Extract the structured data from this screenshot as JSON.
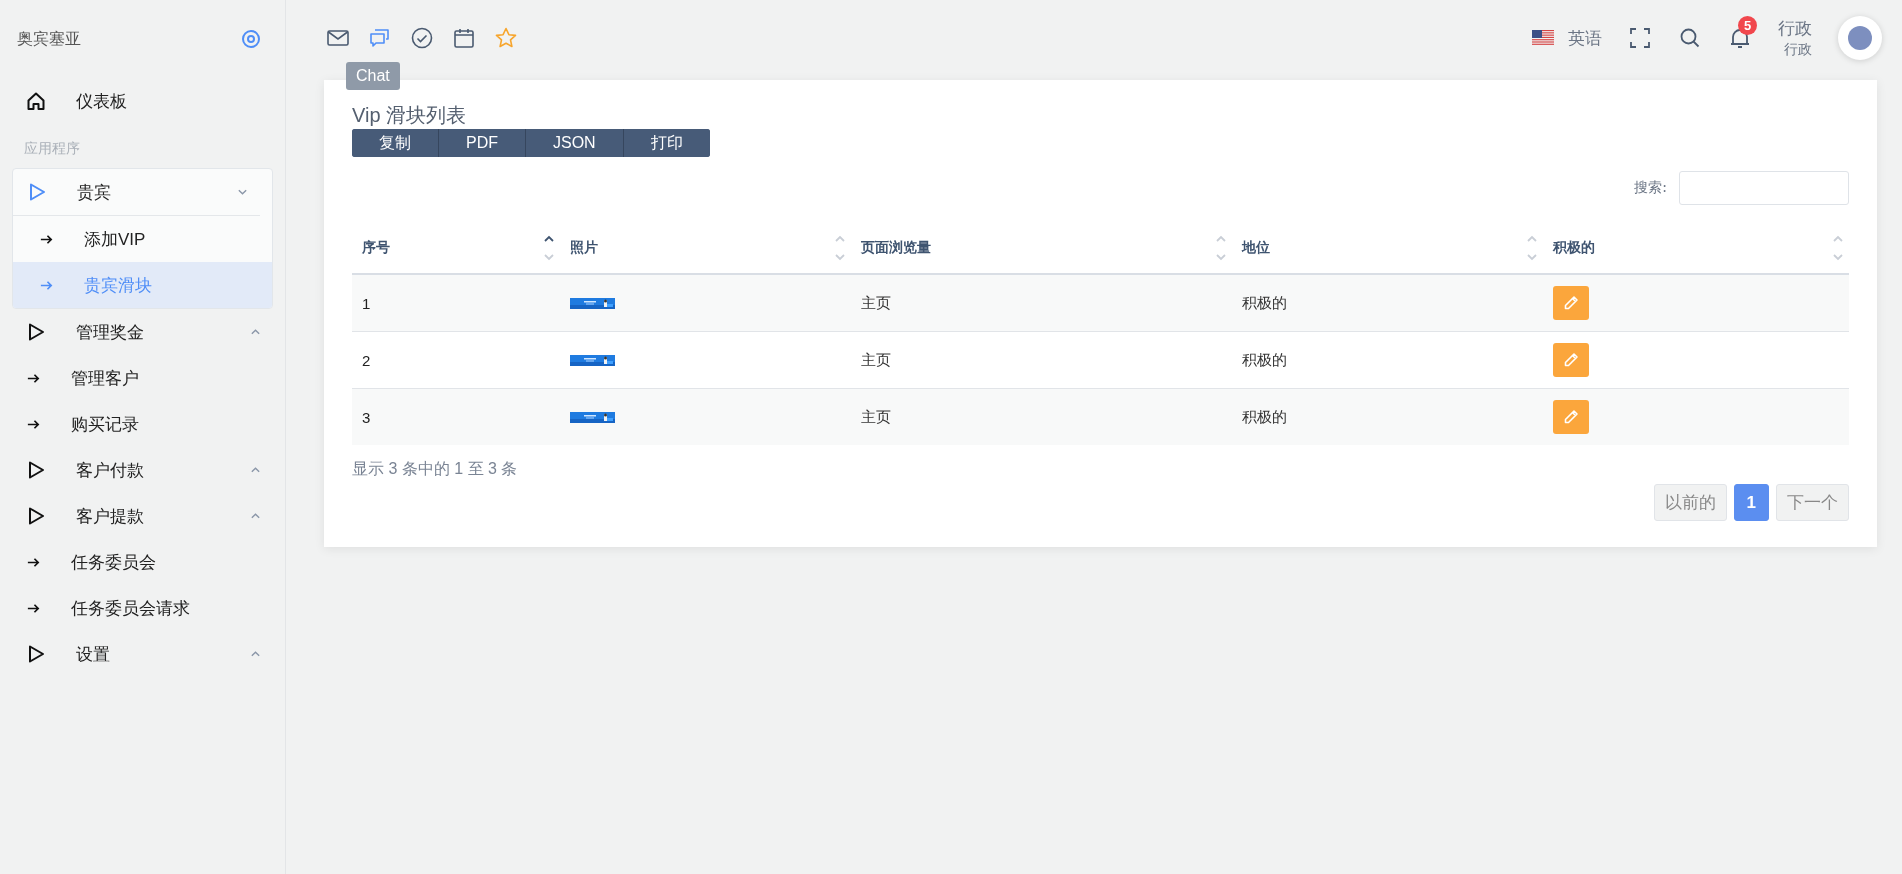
{
  "sidebar": {
    "brand": "奥宾塞亚",
    "items": [
      {
        "kind": "home",
        "label": "仪表板",
        "selected": false
      },
      {
        "kind": "section",
        "label": "应用程序"
      },
      {
        "kind": "group",
        "label": "贵宾",
        "expanded": true,
        "children": [
          {
            "label": "添加VIP",
            "selected": false
          },
          {
            "label": "贵宾滑块",
            "selected": true
          }
        ]
      },
      {
        "kind": "group",
        "label": "管理奖金",
        "expanded": false
      },
      {
        "kind": "link",
        "label": "管理客户",
        "selected": false
      },
      {
        "kind": "link",
        "label": "购买记录",
        "selected": false
      },
      {
        "kind": "group",
        "label": "客户付款",
        "expanded": false
      },
      {
        "kind": "group",
        "label": "客户提款",
        "expanded": false
      },
      {
        "kind": "link",
        "label": "任务委员会",
        "selected": false
      },
      {
        "kind": "link",
        "label": "任务委员会请求",
        "selected": false
      },
      {
        "kind": "group",
        "label": "设置",
        "expanded": false
      }
    ]
  },
  "topbar": {
    "apps": [
      {
        "kind": "mail",
        "selected": false
      },
      {
        "kind": "chat",
        "selected": true
      },
      {
        "kind": "check",
        "selected": false
      },
      {
        "kind": "calendar",
        "selected": false
      },
      {
        "kind": "star",
        "selected": false
      }
    ],
    "tooltip": "Chat",
    "language": "英语",
    "notifications": "5",
    "user_name": "行政",
    "user_role": "行政"
  },
  "card": {
    "title": "Vip 滑块列表",
    "export_buttons": [
      "复制",
      "PDF",
      "JSON",
      "打印"
    ],
    "search_label": "搜索:",
    "table": {
      "columns": [
        {
          "label": "序号",
          "sorted_ascending": true
        },
        {
          "label": "照片",
          "sorted_ascending": false
        },
        {
          "label": "页面浏览量",
          "sorted_ascending": false
        },
        {
          "label": "地位",
          "sorted_ascending": false
        },
        {
          "label": "积极的",
          "sorted_ascending": false
        }
      ],
      "rows": [
        {
          "number": "1",
          "page": "主页",
          "status": "积极的"
        },
        {
          "number": "2",
          "page": "主页",
          "status": "积极的"
        },
        {
          "number": "3",
          "page": "主页",
          "status": "积极的"
        }
      ]
    },
    "info": "显示 3 条中的 1 至 3 条",
    "pagination": [
      {
        "label": "以前的",
        "selected": false
      },
      {
        "label": "1",
        "selected": true
      },
      {
        "label": "下一个",
        "selected": false
      }
    ]
  }
}
